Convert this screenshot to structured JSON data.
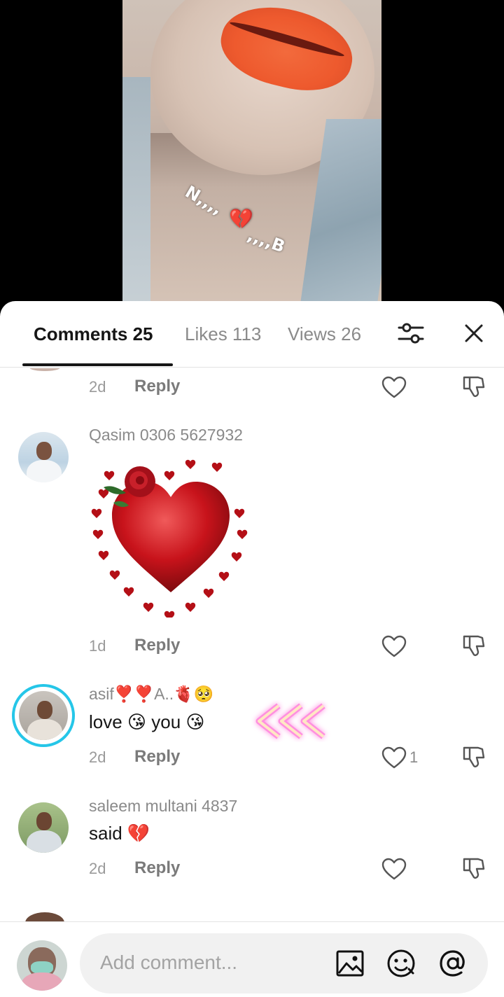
{
  "video": {
    "overlay_left": "N,,,,",
    "overlay_heart": "💔",
    "overlay_right": ",,,,B"
  },
  "tabs": {
    "comments": "Comments 25",
    "likes": "Likes 113",
    "views": "Views 26"
  },
  "icons": {
    "filter": "sliders-icon",
    "close": "close-icon",
    "like": "heart-outline-icon",
    "dislike": "thumb-down-icon",
    "image": "image-icon",
    "emoji": "emoji-icon",
    "mention": "at-icon"
  },
  "comments": [
    {
      "date": "2d",
      "reply": "Reply"
    },
    {
      "username": "Qasim 0306 5627932",
      "sticker": "heart-of-hearts-sticker",
      "date": "1d",
      "reply": "Reply"
    },
    {
      "username": "asif❣️❣️A..🫀🥺",
      "text": "love 😘 you 😘",
      "sticker": "glowing-arrows-sticker",
      "date": "2d",
      "reply": "Reply",
      "likes": "1"
    },
    {
      "username": "saleem multani 4837",
      "text": "said 💔",
      "date": "2d",
      "reply": "Reply"
    }
  ],
  "input": {
    "placeholder": "Add comment..."
  },
  "colors": {
    "text_primary": "#161616",
    "text_secondary": "#8a8a8a",
    "story_ring": "#25c6e8",
    "heart_red": "#c8131b"
  }
}
